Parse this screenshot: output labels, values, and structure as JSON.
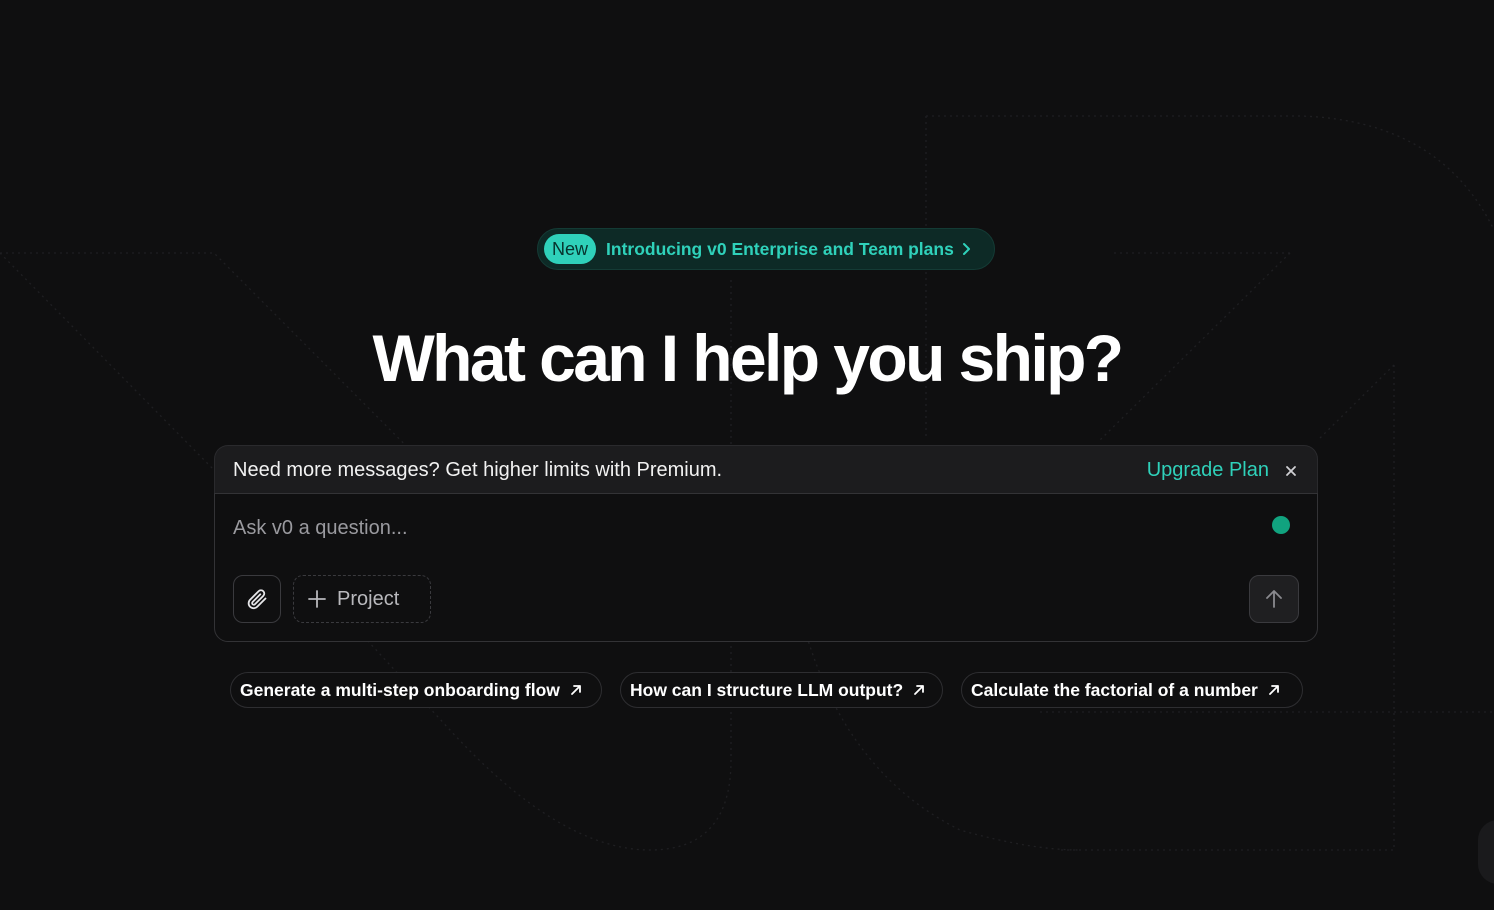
{
  "announcement": {
    "badge": "New",
    "text": "Introducing v0 Enterprise and Team plans"
  },
  "hero": {
    "title": "What can I help you ship?"
  },
  "upsell": {
    "message": "Need more messages? Get higher limits with Premium.",
    "link": "Upgrade Plan"
  },
  "composer": {
    "placeholder": "Ask v0 a question...",
    "project_label": "Project",
    "status_color": "#11a37f"
  },
  "suggestions": [
    "Generate a multi-step onboarding flow",
    "How can I structure LLM output?",
    "Calculate the factorial of a number"
  ],
  "colors": {
    "accent": "#2fd1ba",
    "background": "#0f0f10"
  },
  "icons": {
    "attach": "paperclip-icon",
    "project": "plus-icon",
    "send": "arrow-up-icon",
    "close": "close-icon",
    "announcement": "chevron-right-icon",
    "suggestion": "arrow-up-right-icon"
  }
}
